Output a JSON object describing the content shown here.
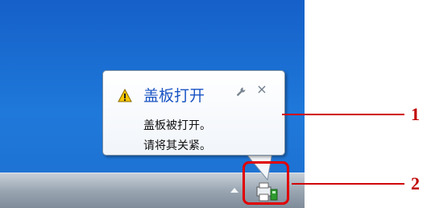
{
  "balloon": {
    "title": "盖板打开",
    "line1": "盖板被打开。",
    "line2": "请将其关紧。",
    "close_glyph": "×"
  },
  "icons": {
    "warning": "warning-icon",
    "wrench": "wrench-icon",
    "close": "close-icon",
    "tray_printer": "printer-icon",
    "tray_overflow": "chevron-up-icon"
  },
  "callouts": {
    "first": "1",
    "second": "2"
  },
  "colors": {
    "desktop_blue": "#1f79da",
    "title_blue": "#1a54c4",
    "callout_red": "#d00000",
    "warning_yellow": "#f7c600"
  }
}
